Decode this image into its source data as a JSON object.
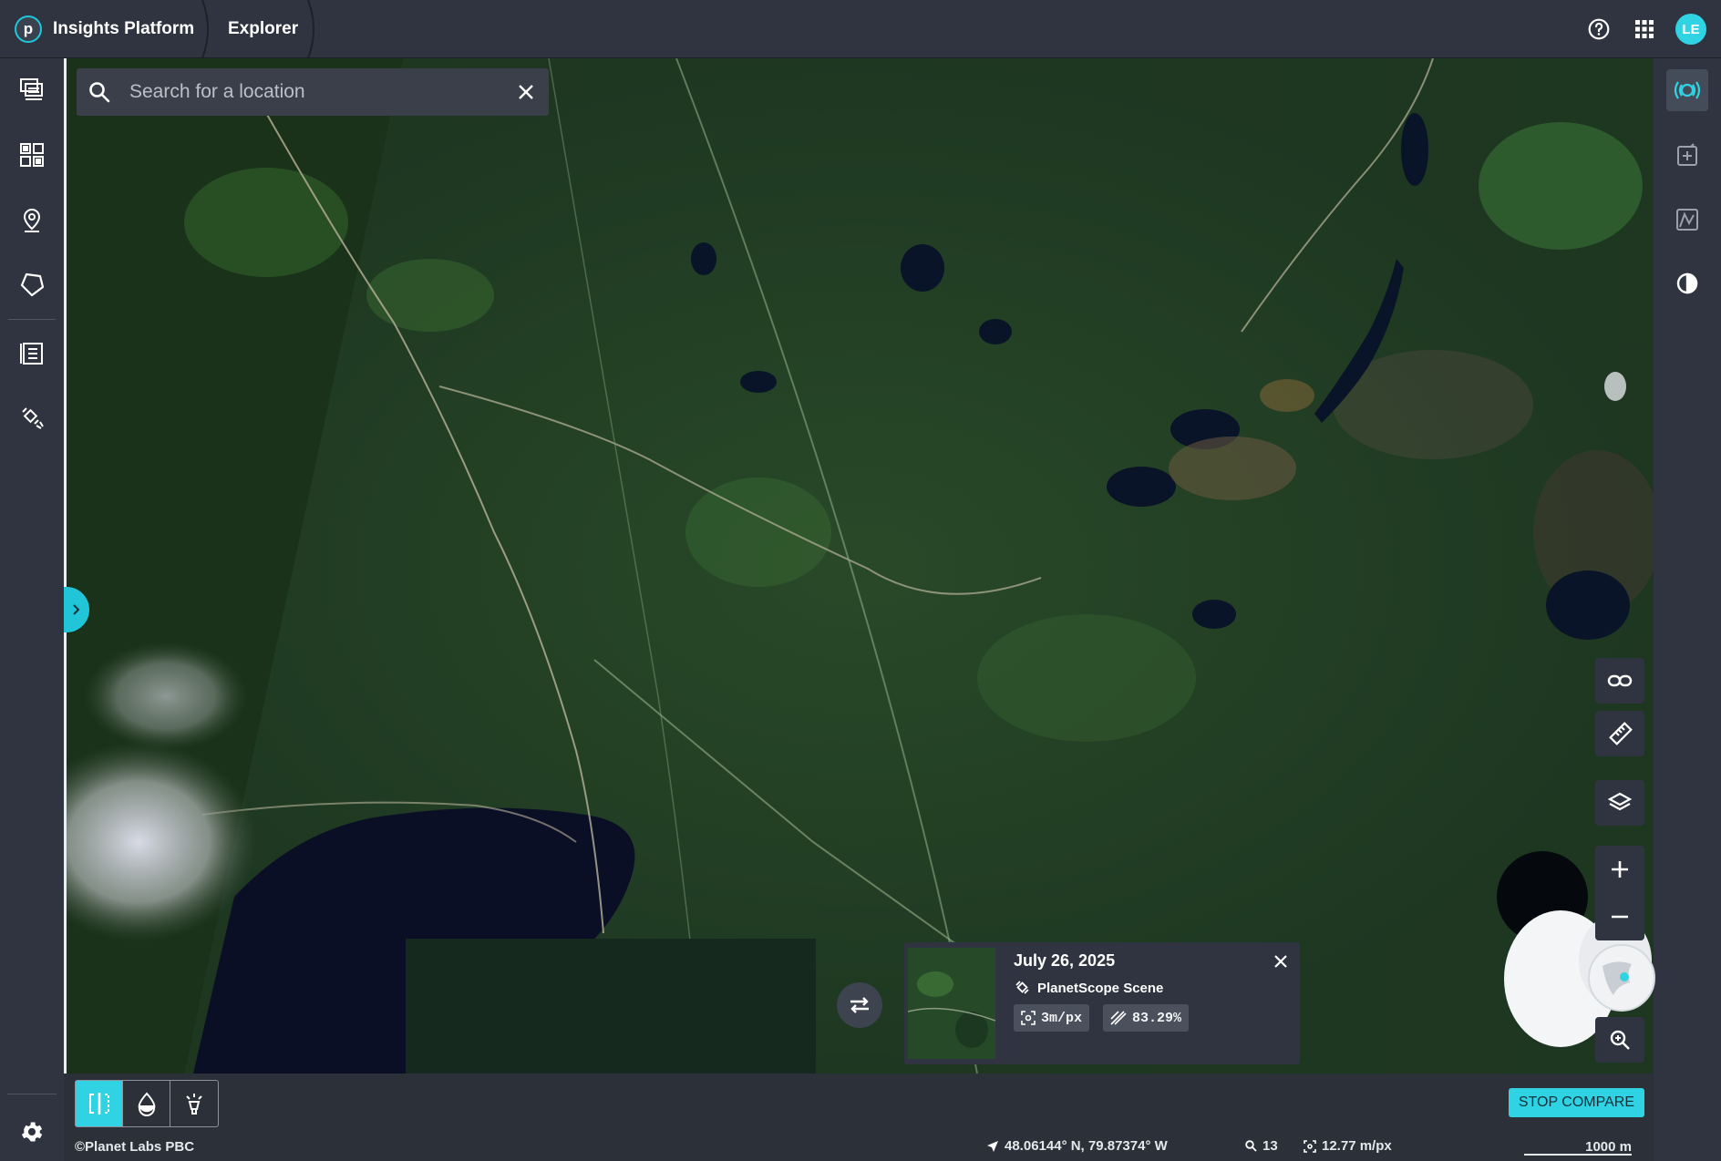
{
  "header": {
    "brand_letter": "p",
    "brand_name": "Insights Platform",
    "tab": "Explorer",
    "avatar_initials": "LE"
  },
  "search": {
    "placeholder": "Search for a location"
  },
  "scene_card": {
    "date": "July 26, 2025",
    "type": "PlanetScope Scene",
    "resolution": "3m/px",
    "coverage": "83.29%"
  },
  "bottom_toolbar": {
    "stop_compare_label": "STOP COMPARE"
  },
  "status": {
    "attribution": "©Planet Labs PBC",
    "coordinates": "48.06144° N, 79.87374° W",
    "zoom": "13",
    "resolution": "12.77 m/px",
    "scale": "1000 m"
  },
  "colors": {
    "accent": "#2fd3e3",
    "panel": "#2f3440"
  }
}
